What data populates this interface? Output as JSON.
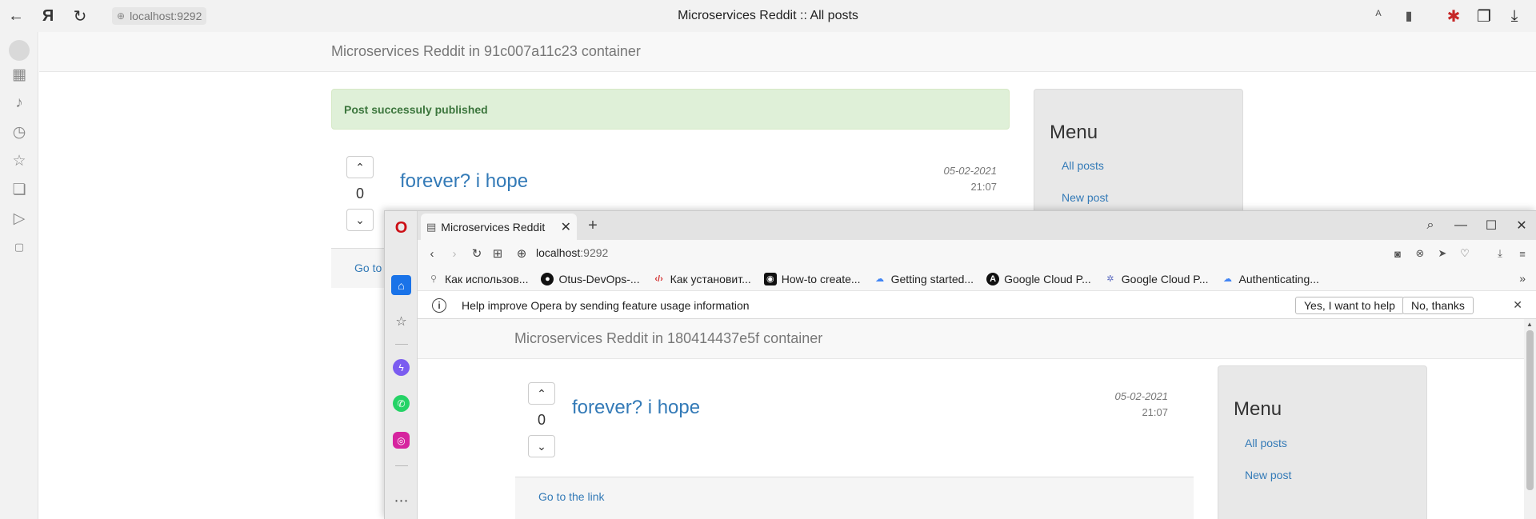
{
  "yandex": {
    "address": "localhost:9292",
    "page_title": "Microservices Reddit :: All posts",
    "back_icon": "←",
    "logo": "Я",
    "reload_icon": "↻"
  },
  "back_page": {
    "brand": "Microservices Reddit in 91c007a11c23 container",
    "alert": "Post successuly published",
    "post": {
      "votes": "0",
      "title": "forever? i hope",
      "date": "05-02-2021",
      "time": "21:07",
      "link": "Go to the link",
      "link_partial": "Go to"
    },
    "menu": {
      "heading": "Menu",
      "all_posts": "All posts",
      "new_post": "New post"
    }
  },
  "opera": {
    "tab_title": "Microservices Reddit",
    "url_host": "localhost",
    "url_port": ":9292",
    "bookmarks": [
      {
        "label": "Как использов...",
        "icon": "⚲",
        "color": "#888888"
      },
      {
        "label": "Otus-DevOps-...",
        "icon": "●",
        "color": "#111111"
      },
      {
        "label": "Как установит...",
        "icon": "‹/›",
        "color": "#d32f2f"
      },
      {
        "label": "How-to create...",
        "icon": "◉",
        "color": "#111111"
      },
      {
        "label": "Getting started...",
        "icon": "☁",
        "color": "#4285f4"
      },
      {
        "label": "Google Cloud P...",
        "icon": "A",
        "color": "#111111"
      },
      {
        "label": "Google Cloud P...",
        "icon": "✲",
        "color": "#5c6bc0"
      },
      {
        "label": "Authenticating...",
        "icon": "☁",
        "color": "#4285f4"
      }
    ],
    "infobar": {
      "text": "Help improve Opera by sending feature usage information",
      "yes": "Yes, I want to help",
      "no": "No, thanks"
    },
    "page": {
      "brand": "Microservices Reddit in 180414437e5f container",
      "post": {
        "votes": "0",
        "title": "forever? i hope",
        "date": "05-02-2021",
        "time": "21:07",
        "link": "Go to the link"
      },
      "menu": {
        "heading": "Menu",
        "all_posts": "All posts",
        "new_post": "New post"
      }
    }
  },
  "colors": {
    "link": "#337ab7",
    "alert_bg": "#dff0d8",
    "alert_text": "#3c763d",
    "opera_red": "#cc0f16"
  }
}
